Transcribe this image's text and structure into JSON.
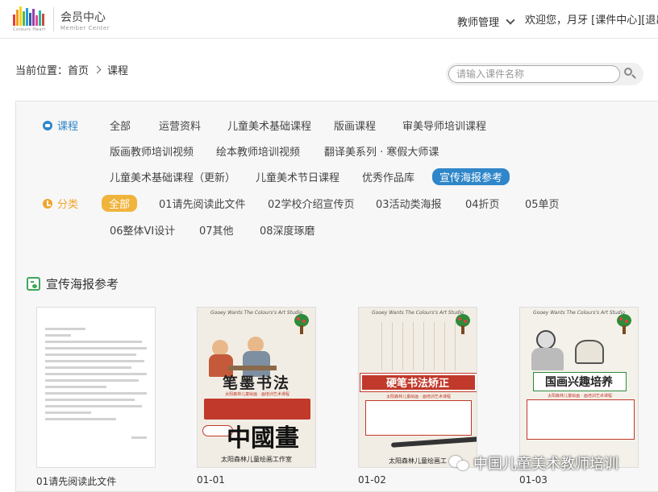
{
  "header": {
    "logo_text": "Colours Heart",
    "member_title": "会员中心",
    "member_subtitle": "Member Center",
    "teacher_manage": "教师管理",
    "welcome": "欢迎您，月牙 [课件中心][退出]"
  },
  "breadcrumb": {
    "label": "当前位置：首页",
    "current": "课程"
  },
  "search": {
    "placeholder": "请输入课件名称"
  },
  "course_filter": {
    "label": "课程",
    "items": [
      "全部",
      "运营资料",
      "儿童美术基础课程",
      "版画课程",
      "审美导师培训课程",
      "版画教师培训视频",
      "绘本教师培训视频",
      "翻译美系列 · 寒假大师课",
      "儿童美术基础课程（更新）",
      "儿童美术节日课程",
      "优秀作品库",
      "宣传海报参考"
    ],
    "active": "宣传海报参考"
  },
  "category_filter": {
    "label": "分类",
    "items": [
      "全部",
      "01请先阅读此文件",
      "02学校介绍宣传页",
      "03活动类海报",
      "04折页",
      "05单页",
      "06整体VI设计",
      "07其他",
      "08深度琢磨"
    ],
    "active": "全部"
  },
  "section": {
    "title": "宣传海报参考"
  },
  "cards": [
    {
      "caption": "01请先阅读此文件"
    },
    {
      "caption": "01-01",
      "poster_header": "Gooey Wants The Colours's Art Studio",
      "poster_title": "笔墨书法",
      "poster_subtitle": "太阳森林儿童绘画 · 画培训艺术课程",
      "poster_brush": "中國畫",
      "poster_footer": "太阳森林儿童绘画工作室"
    },
    {
      "caption": "01-02",
      "poster_header": "Gooey Wants The Colours's Art Studio",
      "poster_title": "硬笔书法矫正",
      "poster_subtitle": "太阳森林儿童绘画 · 画培训艺术课程",
      "poster_footer": "太阳森林儿童绘画工"
    },
    {
      "caption": "01-03",
      "poster_header": "Gooey Wants The Colours's Art Studio",
      "poster_title": "国画兴趣培养",
      "poster_subtitle": "太阳森林儿童绘画 · 画培训艺术课程"
    }
  ],
  "watermark": "中国儿童美术教师培训",
  "colors": {
    "accent_blue": "#2f86c9",
    "accent_orange": "#f0a52c",
    "poster_red": "#c0392b"
  }
}
